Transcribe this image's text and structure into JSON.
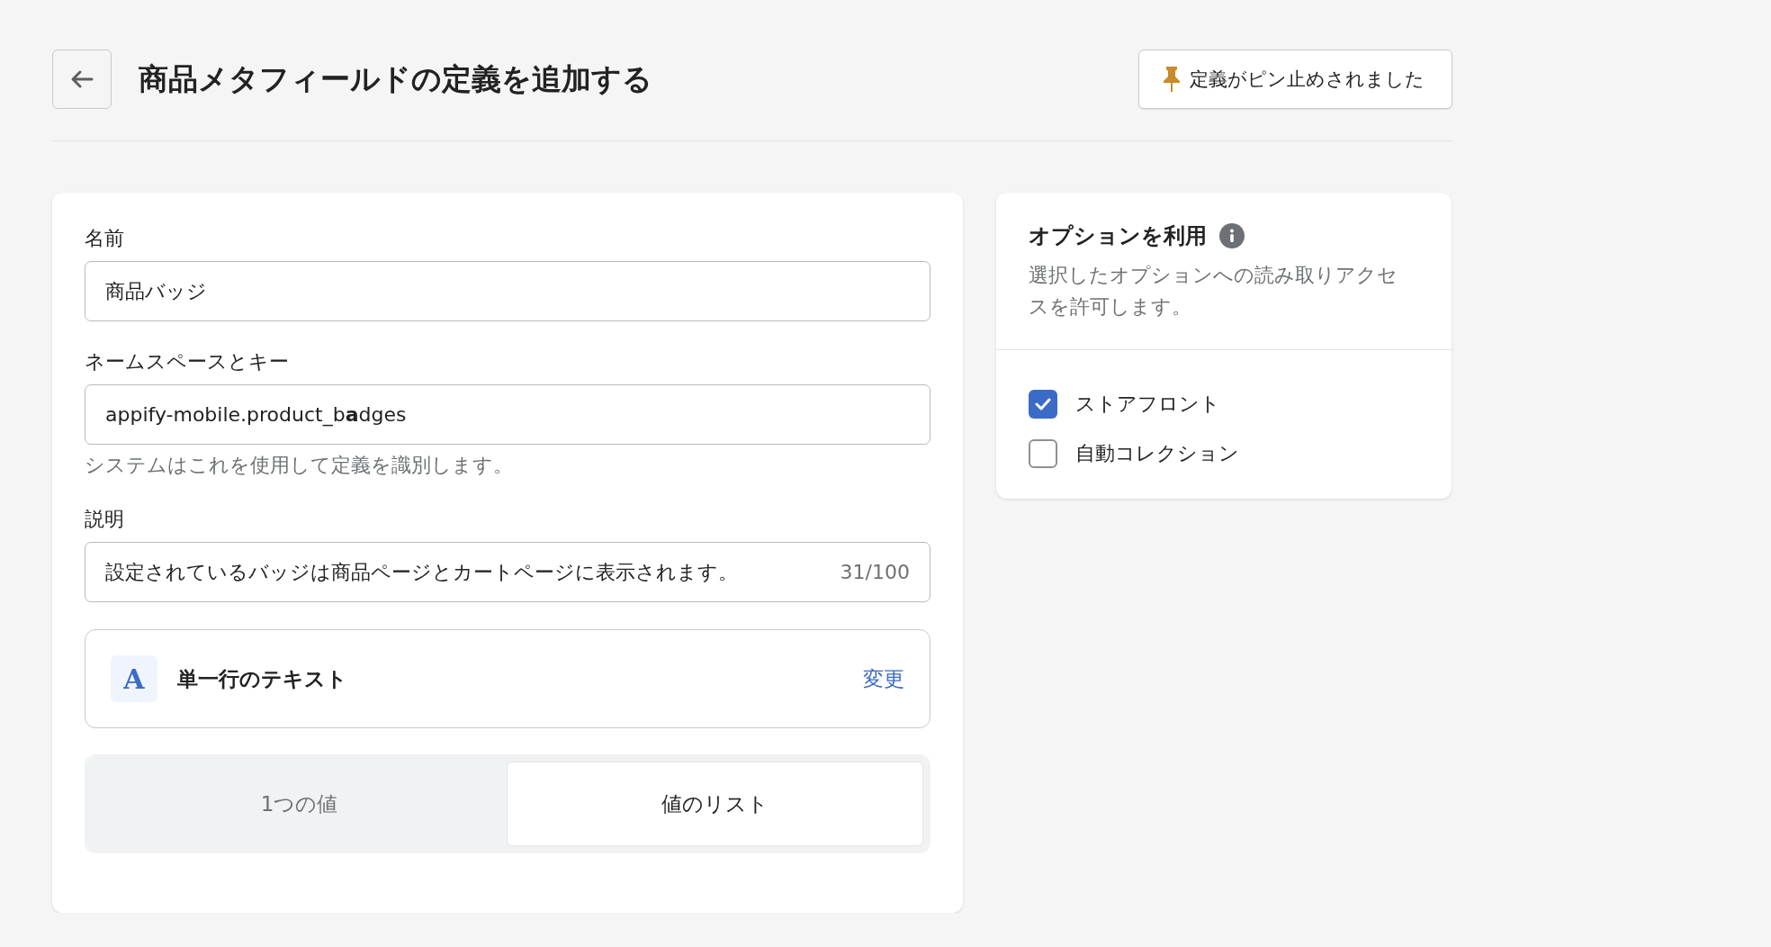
{
  "header": {
    "title": "商品メタフィールドの定義を追加する",
    "pin_button": "定義がピン止めされました"
  },
  "form": {
    "fields": [
      {
        "label": "名前",
        "value": "商品バッジ"
      },
      {
        "label": "ネームスペースとキー",
        "value": "appify-mobile.product_b**a**dges",
        "help": "システムはこれを使用して定義を識別します。"
      },
      {
        "label": "説明",
        "value": "設定されているバッジは商品ページとカートページに表示されます。",
        "counter": "31/100"
      }
    ],
    "type": {
      "name": "単一行のテキスト",
      "icon_letter": "A",
      "action": "変更"
    },
    "segments": [
      {
        "label": "1つの値",
        "selected": false
      },
      {
        "label": "値のリスト",
        "selected": true
      }
    ]
  },
  "options": {
    "title": "オプションを利用",
    "description": "選択したオプションへの読み取りアクセスを許可します。",
    "items": [
      {
        "label": "ストアフロント",
        "checked": true
      },
      {
        "label": "自動コレクション",
        "checked": false
      }
    ]
  }
}
